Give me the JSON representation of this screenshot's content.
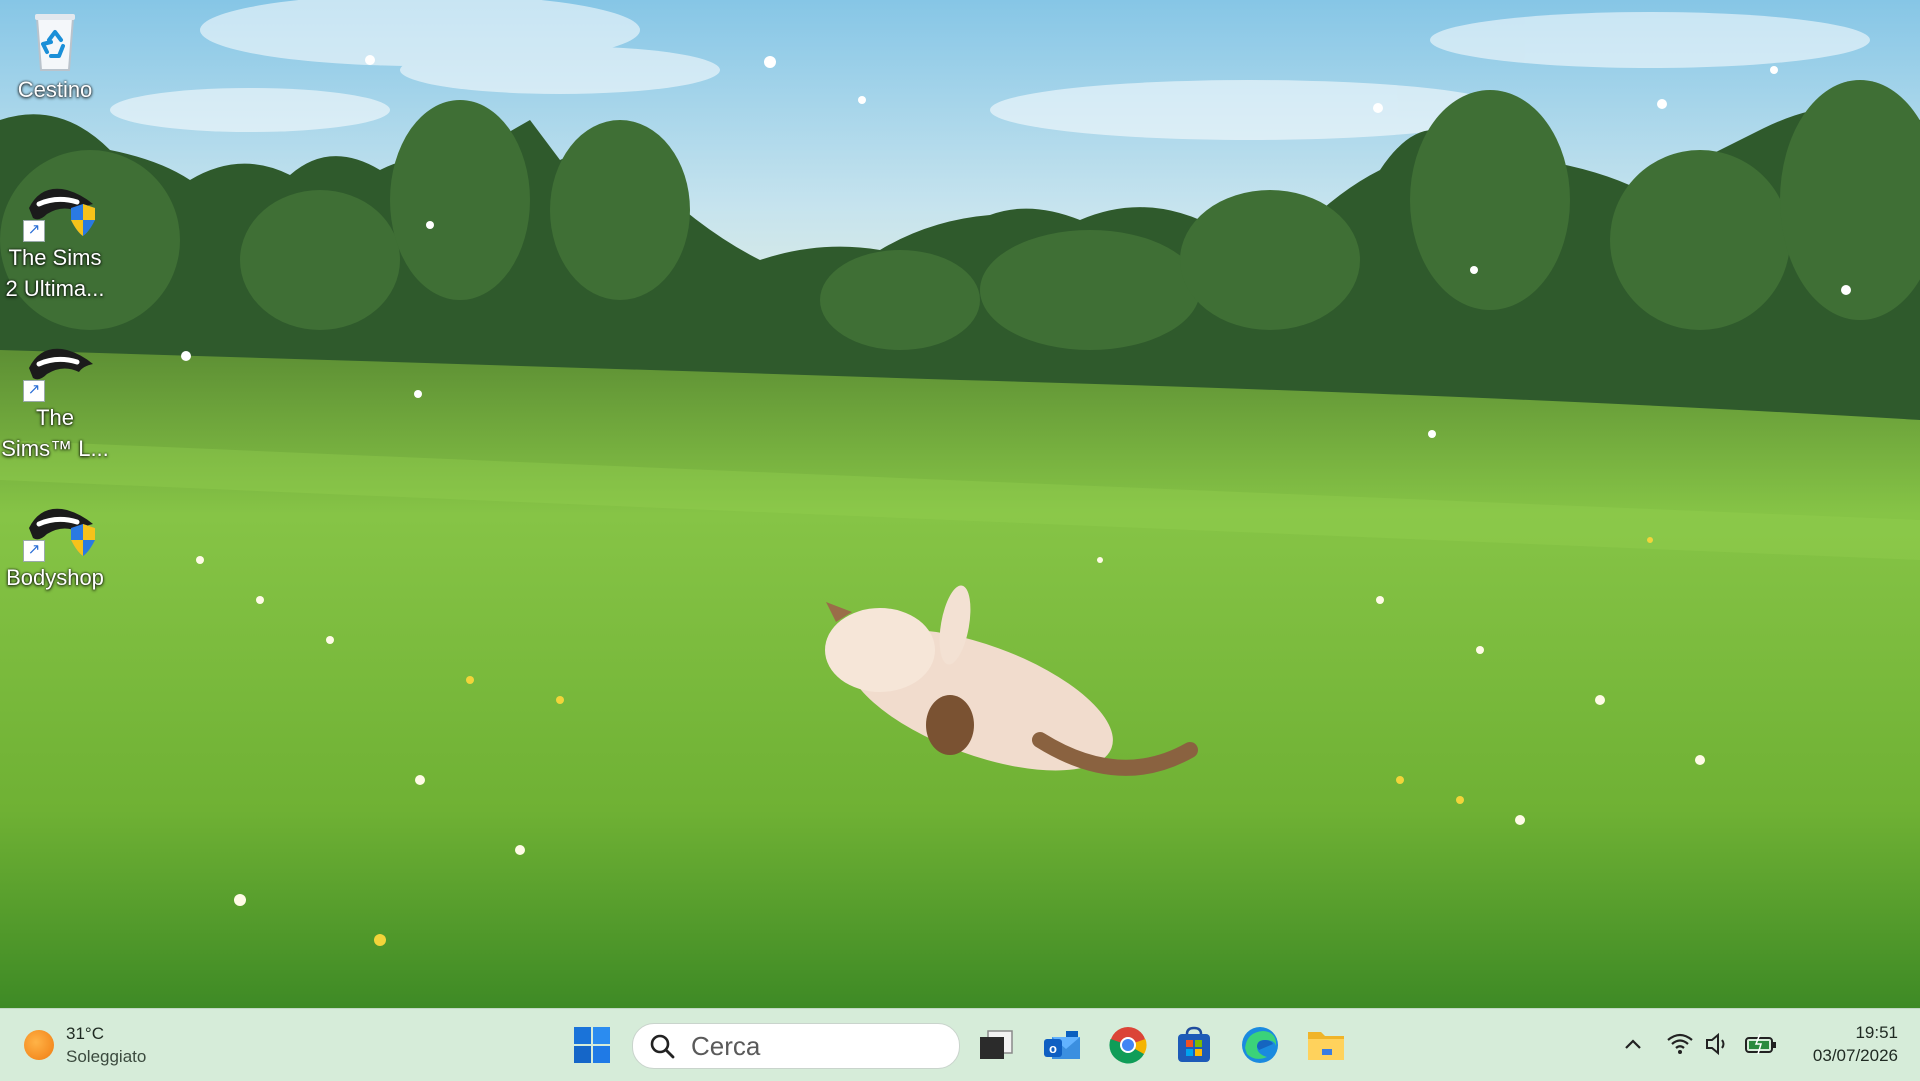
{
  "desktop": {
    "icons": [
      {
        "label": "Cestino",
        "icon": "recycle-bin-icon"
      },
      {
        "label": "The Sims 2 Ultima...",
        "icon": "sims2-ultimate-icon",
        "line1": "The Sims",
        "line2": "2 Ultima..."
      },
      {
        "label": "The Sims™ L...",
        "icon": "sims-life-stories-icon",
        "line1": "The",
        "line2": "Sims™ L..."
      },
      {
        "label": "Bodyshop",
        "icon": "bodyshop-icon"
      }
    ]
  },
  "taskbar": {
    "weather": {
      "temperature": "31°C",
      "condition": "Soleggiato",
      "icon": "sun-icon"
    },
    "start": {
      "icon": "windows-logo-icon"
    },
    "search": {
      "placeholder": "Cerca",
      "icon": "search-icon"
    },
    "apps": [
      {
        "name": "task-view",
        "icon": "task-view-icon"
      },
      {
        "name": "outlook",
        "icon": "outlook-icon"
      },
      {
        "name": "chrome",
        "icon": "chrome-icon"
      },
      {
        "name": "microsoft-store",
        "icon": "store-icon"
      },
      {
        "name": "edge",
        "icon": "edge-icon"
      },
      {
        "name": "file-explorer",
        "icon": "folder-icon"
      }
    ],
    "tray": {
      "icons": [
        "chevron-up-icon",
        "wifi-icon",
        "volume-icon",
        "battery-icon"
      ]
    },
    "clock": {
      "time": "19:51",
      "date": "03/07/2026"
    }
  },
  "colors": {
    "taskbar": "#d6ecd9",
    "start_blue": "#0078d4",
    "sky": "#9fd0e8",
    "grass": "#79b93a"
  }
}
